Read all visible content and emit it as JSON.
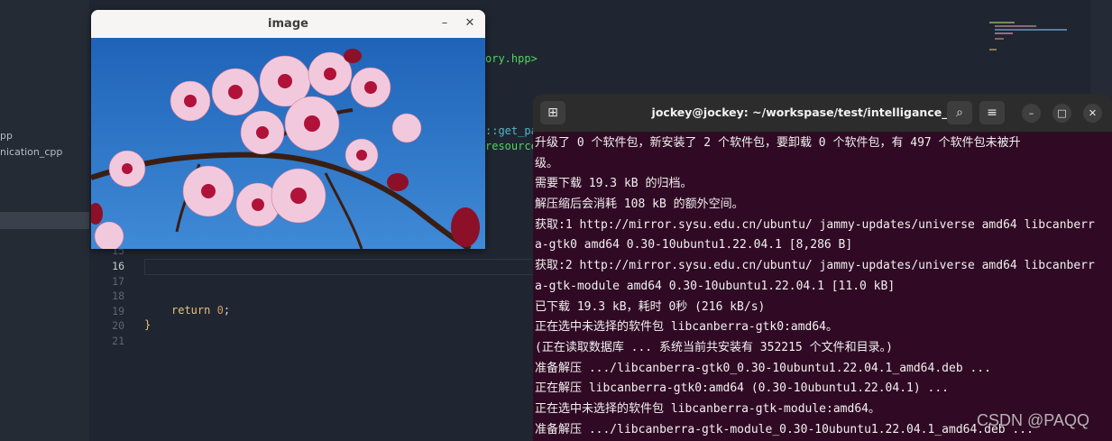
{
  "sidebar": {
    "items": [
      {
        "label": "pp"
      },
      {
        "label": "nication_cpp"
      }
    ]
  },
  "editor": {
    "line_numbers": [
      "16",
      "17",
      "18",
      "19",
      "20",
      "21"
    ],
    "partial_line_number": "15",
    "include_fragment": "ory.hpp>",
    "fragment_get": "::get_pa",
    "fragment_resource": "resource",
    "code_return_kw": "return",
    "code_return_val": "0",
    "code_semicolon": ";",
    "code_close_brace": "}"
  },
  "image_window": {
    "title": "image",
    "minimize_glyph": "–",
    "close_glyph": "✕"
  },
  "terminal": {
    "title": "jockey@jockey: ~/workspase/test/intelligance_ws",
    "new_tab_glyph": "⊞",
    "search_glyph": "⌕",
    "menu_glyph": "≡",
    "minimize_glyph": "–",
    "maximize_glyph": "□",
    "close_glyph": "✕",
    "lines": [
      "升级了 0 个软件包，新安装了 2 个软件包，要卸载 0 个软件包，有 497 个软件包未被升",
      "级。",
      "需要下载 19.3 kB 的归档。",
      "解压缩后会消耗 108 kB 的额外空间。",
      "获取:1 http://mirror.sysu.edu.cn/ubuntu/ jammy-updates/universe amd64 libcanberr",
      "a-gtk0 amd64 0.30-10ubuntu1.22.04.1 [8,286 B]",
      "获取:2 http://mirror.sysu.edu.cn/ubuntu/ jammy-updates/universe amd64 libcanberr",
      "a-gtk-module amd64 0.30-10ubuntu1.22.04.1 [11.0 kB]",
      "已下载 19.3 kB，耗时 0秒 (216 kB/s)",
      "正在选中未选择的软件包 libcanberra-gtk0:amd64。",
      "(正在读取数据库 ... 系统当前共安装有 352215 个文件和目录。)",
      "准备解压 .../libcanberra-gtk0_0.30-10ubuntu1.22.04.1_amd64.deb  ...",
      "正在解压 libcanberra-gtk0:amd64 (0.30-10ubuntu1.22.04.1) ...",
      "正在选中未选择的软件包 libcanberra-gtk-module:amd64。",
      "准备解压 .../libcanberra-gtk-module_0.30-10ubuntu1.22.04.1_amd64.deb  ..."
    ]
  },
  "watermark": "CSDN @PAQQ"
}
